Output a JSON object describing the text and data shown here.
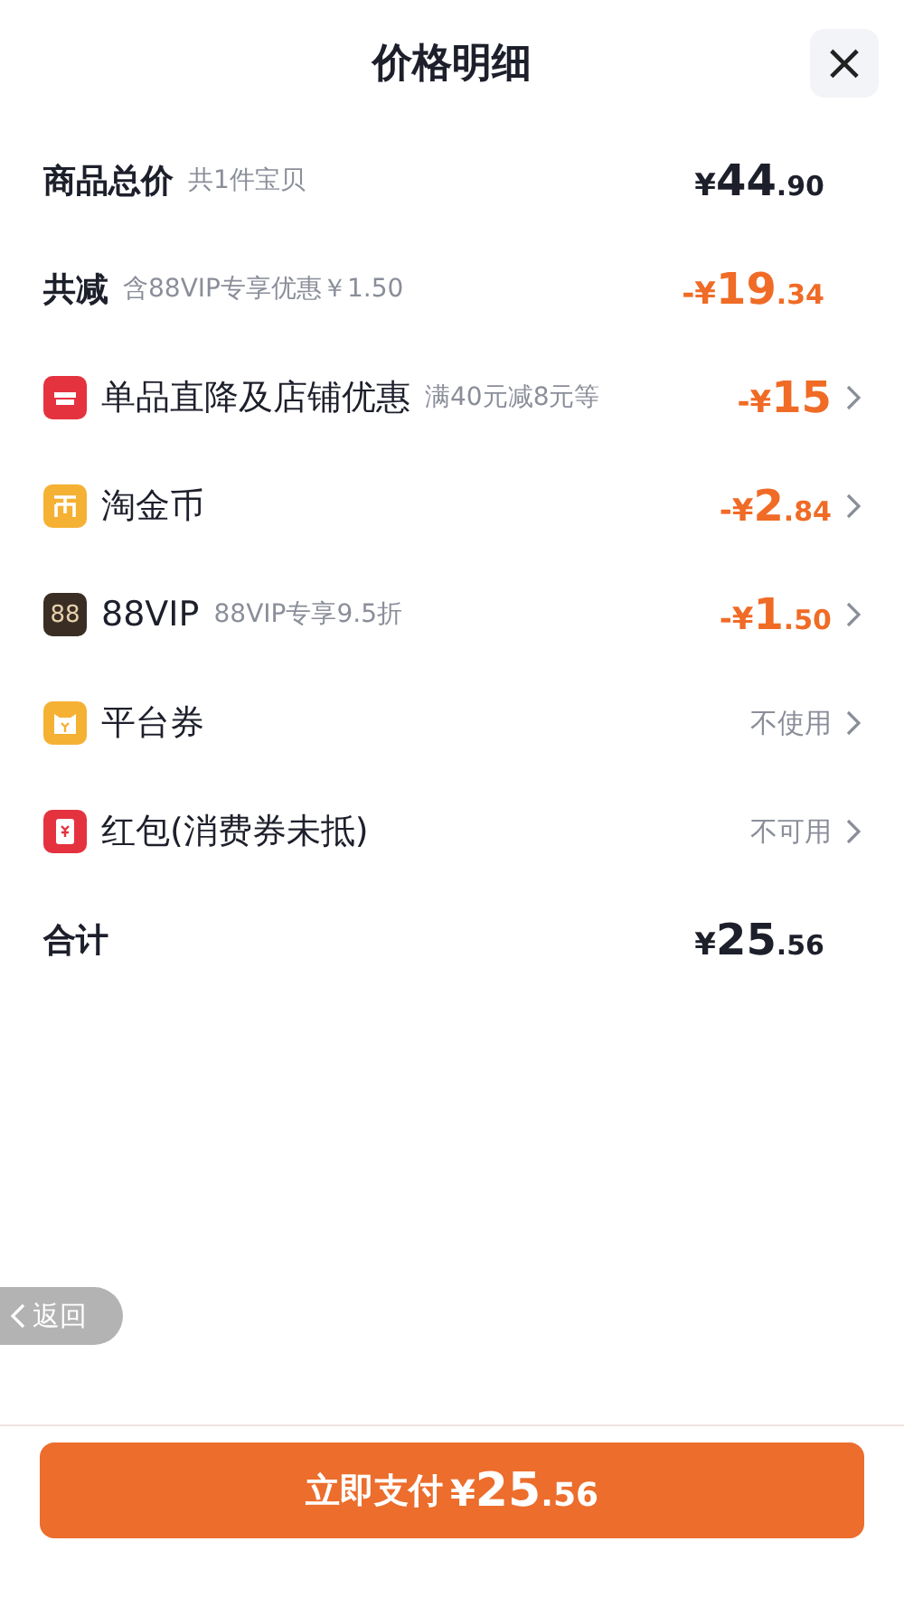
{
  "header": {
    "title": "价格明细",
    "close_label": "×"
  },
  "rows": [
    {
      "kind": "subtotal",
      "label": "商品总价",
      "note": "共1件宝贝",
      "amount": "¥44.90"
    },
    {
      "kind": "savings",
      "label": "共减",
      "note": "含88VIP专享优惠￥1.50",
      "amount": "-¥19.34"
    },
    {
      "kind": "shop",
      "label": "单品直降及店铺优惠",
      "note": "满40元减8元等",
      "amount": "-¥15"
    },
    {
      "kind": "coins",
      "label": "淘金币",
      "amount": "-¥2.84"
    },
    {
      "kind": "vip",
      "icon_text": "88",
      "label": "88VIP",
      "note": "88VIP专享9.5折",
      "amount": "-¥1.50"
    },
    {
      "kind": "coupon",
      "label": "平台券",
      "status": "不使用"
    },
    {
      "kind": "envelope",
      "label": "红包(消费券未抵)",
      "status": "不可用"
    },
    {
      "kind": "total",
      "label": "合计",
      "amount": "¥25.56"
    }
  ],
  "back_button": {
    "label": "返回"
  },
  "pay_button": {
    "label": "立即支付",
    "amount": "¥25.56"
  }
}
